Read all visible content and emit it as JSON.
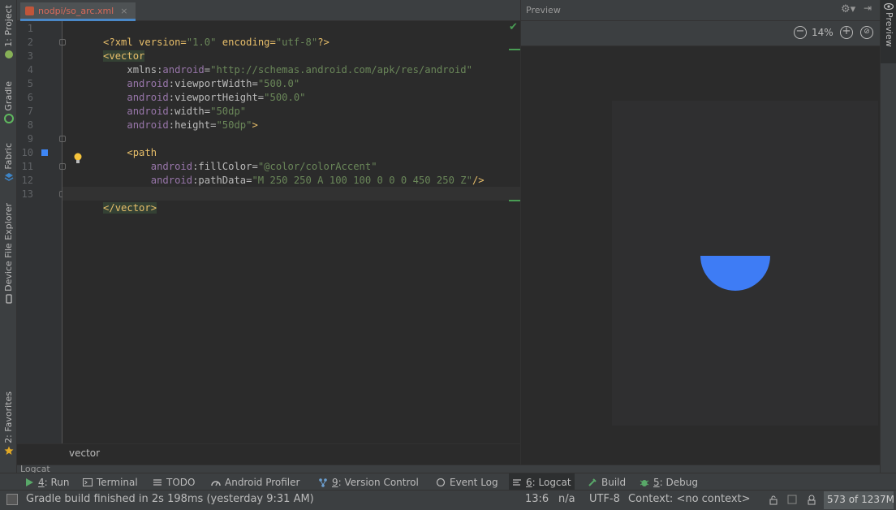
{
  "left_tool_tabs": [
    {
      "label": "1: Project",
      "icon": "project-icon"
    },
    {
      "label": "Gradle",
      "icon": "gradle-icon"
    },
    {
      "label": "Fabric",
      "icon": "fabric-icon"
    },
    {
      "label": "Device File Explorer",
      "icon": "device-icon"
    },
    {
      "label": "2: Favorites",
      "icon": "star-icon"
    }
  ],
  "editor": {
    "tab_label": "nodpi/so_arc.xml",
    "close_glyph": "×",
    "line_numbers": [
      "1",
      "2",
      "3",
      "4",
      "5",
      "6",
      "7",
      "8",
      "9",
      "10",
      "11",
      "12",
      "13"
    ],
    "code": {
      "l1_a": "<?xml version=",
      "l1_b": "\"1.0\"",
      "l1_c": " encoding=",
      "l1_d": "\"utf-8\"",
      "l1_e": "?>",
      "l2": "<vector",
      "l3_a": "    xmlns:",
      "l3_b": "android",
      "l3_c": "=",
      "l3_d": "\"http://schemas.android.com/apk/res/android\"",
      "l4_a": "    android",
      "l4_b": ":viewportWidth=",
      "l4_c": "\"500.0\"",
      "l5_a": "    android",
      "l5_b": ":viewportHeight=",
      "l5_c": "\"500.0\"",
      "l6_a": "    android",
      "l6_b": ":width=",
      "l6_c": "\"50dp\"",
      "l7_a": "    android",
      "l7_b": ":height=",
      "l7_c": "\"50dp\"",
      "l7_d": ">",
      "l9": "    <path",
      "l10_a": "        android",
      "l10_b": ":fillColor=",
      "l10_c": "\"@color/colorAccent\"",
      "l11_a": "        android",
      "l11_b": ":pathData=",
      "l11_c": "\"M 250 250 A 100 100 0 0 0 450 250 Z\"",
      "l11_d": "/>",
      "l13": "</vector>"
    },
    "breadcrumb": "vector"
  },
  "preview": {
    "title": "Preview",
    "zoom": "14%",
    "shape_color": "#3e7cf5",
    "side_tab": "Preview"
  },
  "logcat_strip": "Logcat",
  "tool_windows": [
    {
      "num": "4",
      "rest": ": Run",
      "icon": "run-icon"
    },
    {
      "num": "",
      "rest": "Terminal",
      "icon": "terminal-icon"
    },
    {
      "num": "",
      "rest": "TODO",
      "icon": "todo-icon"
    },
    {
      "num": "",
      "rest": "Android Profiler",
      "icon": "profiler-icon"
    },
    {
      "num": "9",
      "rest": ": Version Control",
      "icon": "vcs-icon"
    },
    {
      "num": "",
      "rest": "Event Log",
      "icon": "event-log-icon"
    },
    {
      "num": "6",
      "rest": ": Logcat",
      "icon": "logcat-icon"
    },
    {
      "num": "",
      "rest": "Build",
      "icon": "build-icon"
    },
    {
      "num": "5",
      "rest": ": Debug",
      "icon": "debug-icon"
    }
  ],
  "status": {
    "message": "Gradle build finished in 2s 198ms (yesterday 9:31 AM)",
    "position": "13:6",
    "line_sep": "n/a",
    "encoding": "UTF-8",
    "context": "Context: <no context>",
    "memory": "573 of 1237M"
  },
  "colors": {
    "accent": "#4a88c7",
    "tag": "#e8bf6a",
    "string": "#6a8759",
    "namespace": "#9876aa"
  }
}
